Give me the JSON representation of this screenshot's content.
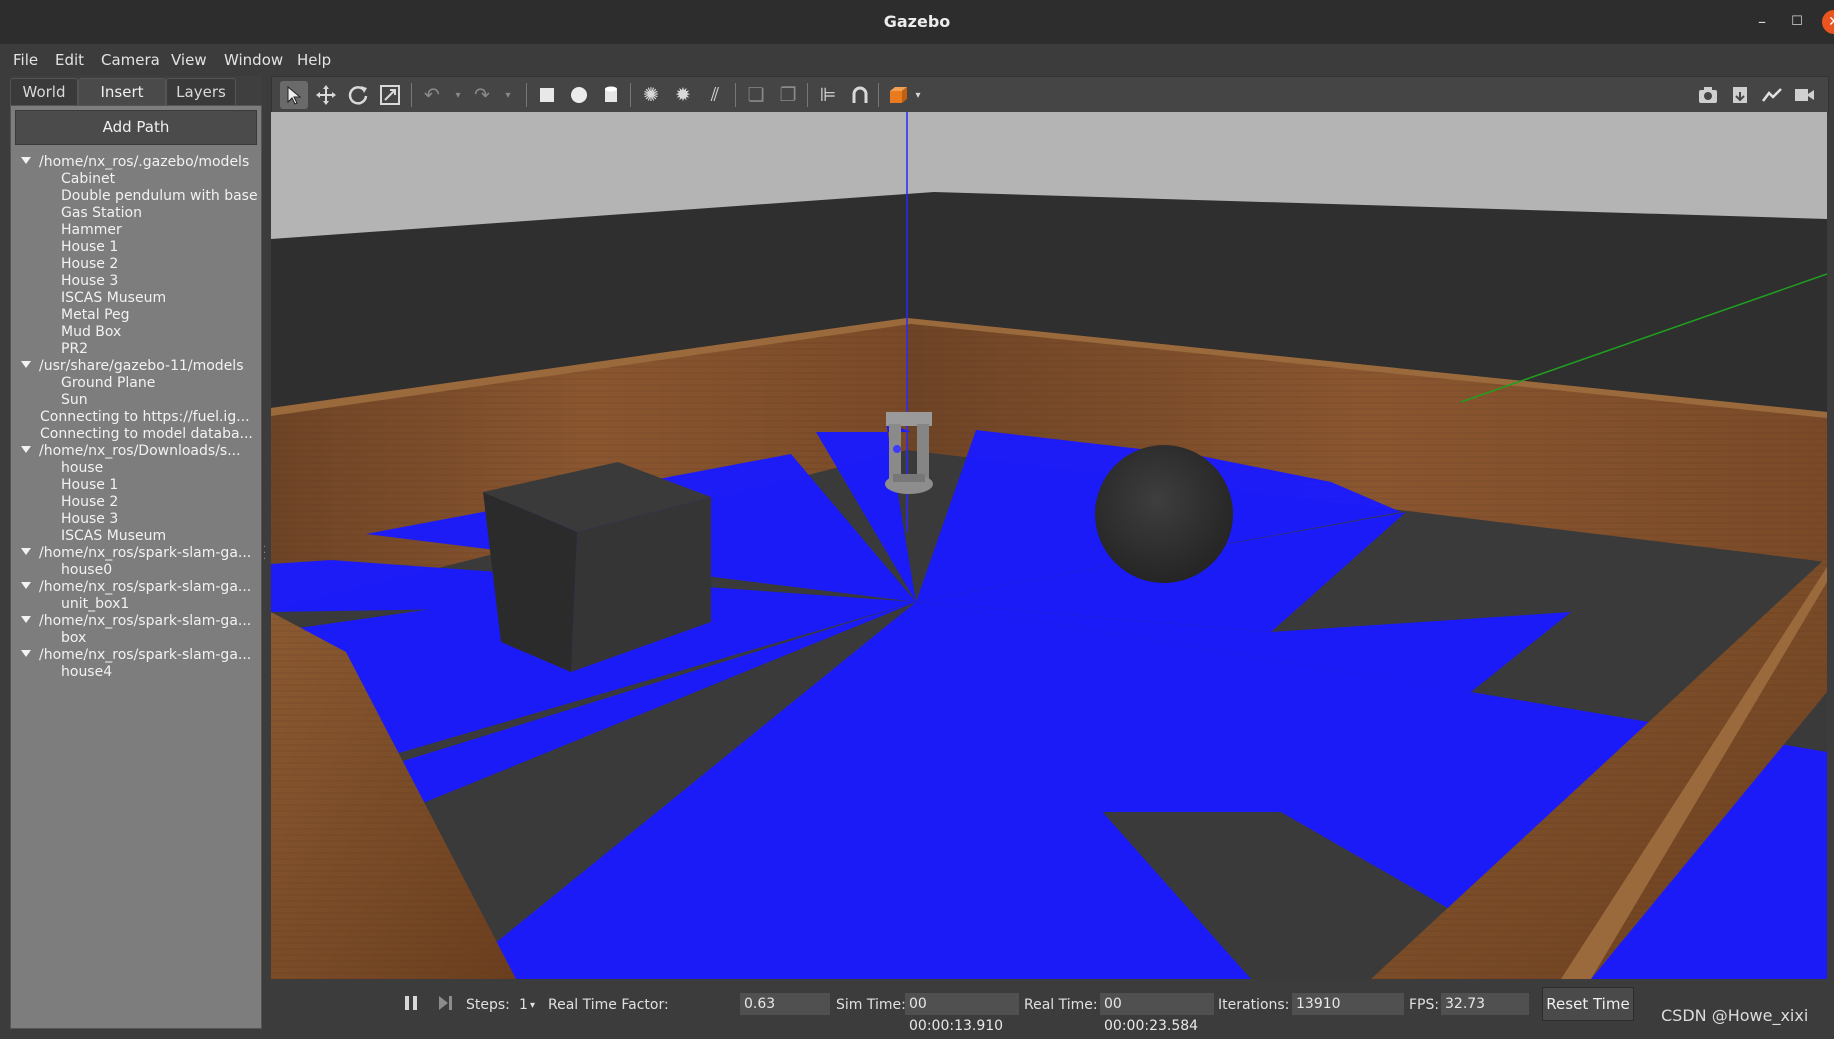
{
  "window": {
    "title": "Gazebo"
  },
  "menu": [
    "File",
    "Edit",
    "Camera",
    "View",
    "Window",
    "Help"
  ],
  "left_panel": {
    "tabs": [
      {
        "label": "World",
        "active": false
      },
      {
        "label": "Insert",
        "active": true
      },
      {
        "label": "Layers",
        "active": false
      }
    ],
    "add_path_label": "Add Path",
    "tree": [
      {
        "type": "root",
        "label": "/home/nx_ros/.gazebo/models"
      },
      {
        "type": "child",
        "label": "Cabinet"
      },
      {
        "type": "child",
        "label": "Double pendulum with base"
      },
      {
        "type": "child",
        "label": "Gas Station"
      },
      {
        "type": "child",
        "label": "Hammer"
      },
      {
        "type": "child",
        "label": "House 1"
      },
      {
        "type": "child",
        "label": "House 2"
      },
      {
        "type": "child",
        "label": "House 3"
      },
      {
        "type": "child",
        "label": "ISCAS Museum"
      },
      {
        "type": "child",
        "label": "Metal Peg"
      },
      {
        "type": "child",
        "label": "Mud Box"
      },
      {
        "type": "child",
        "label": "PR2"
      },
      {
        "type": "root",
        "label": "/usr/share/gazebo-11/models"
      },
      {
        "type": "child",
        "label": "Ground Plane"
      },
      {
        "type": "child",
        "label": "Sun"
      },
      {
        "type": "plain",
        "label": "Connecting to https://fuel.ig..."
      },
      {
        "type": "plain",
        "label": "Connecting to model databa..."
      },
      {
        "type": "root",
        "label": "/home/nx_ros/Downloads/s..."
      },
      {
        "type": "child",
        "label": "house"
      },
      {
        "type": "child",
        "label": "House 1"
      },
      {
        "type": "child",
        "label": "House 2"
      },
      {
        "type": "child",
        "label": "House 3"
      },
      {
        "type": "child",
        "label": "ISCAS Museum"
      },
      {
        "type": "root",
        "label": "/home/nx_ros/spark-slam-ga..."
      },
      {
        "type": "child",
        "label": "house0"
      },
      {
        "type": "root",
        "label": "/home/nx_ros/spark-slam-ga..."
      },
      {
        "type": "child",
        "label": "unit_box1"
      },
      {
        "type": "root",
        "label": "/home/nx_ros/spark-slam-ga..."
      },
      {
        "type": "child",
        "label": "box"
      },
      {
        "type": "root",
        "label": "/home/nx_ros/spark-slam-ga..."
      },
      {
        "type": "child",
        "label": "house4"
      }
    ]
  },
  "toolbar": {
    "icons": [
      "select-arrow-icon",
      "translate-icon",
      "rotate-icon",
      "scale-icon",
      "undo-icon",
      "redo-icon",
      "box-icon",
      "sphere-icon",
      "cylinder-icon",
      "point-light-icon",
      "spot-light-icon",
      "directional-light-icon",
      "copy-icon",
      "paste-icon",
      "align-icon",
      "snap-icon",
      "view-angle-icon",
      "screenshot-icon",
      "log-icon",
      "plot-icon",
      "video-record-icon"
    ]
  },
  "status": {
    "steps_label": "Steps:",
    "steps_value": "1",
    "rtf_label": "Real Time Factor:",
    "rtf_value": "0.63",
    "sim_time_label": "Sim Time:",
    "sim_time_value": "00 00:00:13.910",
    "real_time_label": "Real Time:",
    "real_time_value": "00 00:00:23.584",
    "iterations_label": "Iterations:",
    "iterations_value": "13910",
    "fps_label": "FPS:",
    "fps_value": "32.73",
    "reset_label": "Reset Time"
  },
  "watermark": "CSDN @Howe_xixi",
  "colors": {
    "accent_close": "#e95420",
    "laser": "#1a1aff",
    "wall_wood": "#7a4a26"
  }
}
